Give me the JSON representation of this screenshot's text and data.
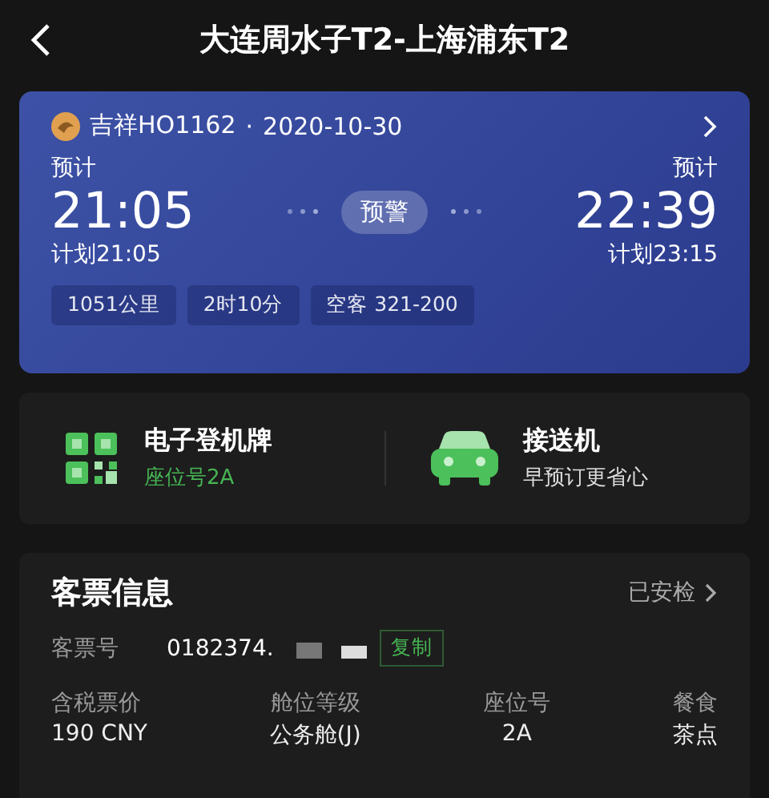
{
  "header": {
    "title": "大连周水子T2-上海浦东T2"
  },
  "flight": {
    "airline_flight": "吉祥HO1162",
    "separator": "·",
    "date": "2020-10-30",
    "departure": {
      "label": "预计",
      "time": "21:05",
      "planned": "计划21:05"
    },
    "status": "预警",
    "arrival": {
      "label": "预计",
      "time": "22:39",
      "planned": "计划23:15"
    },
    "tags": [
      "1051公里",
      "2时10分",
      "空客 321-200"
    ]
  },
  "services": [
    {
      "kind": "boarding-pass",
      "title": "电子登机牌",
      "subtitle": "座位号2A",
      "highlight": true
    },
    {
      "kind": "transfer",
      "title": "接送机",
      "subtitle": "早预订更省心",
      "highlight": false
    }
  ],
  "ticket": {
    "title": "客票信息",
    "status": "已安检",
    "number_label": "客票号",
    "number": "0182374.",
    "copy_button": "复制",
    "columns": [
      {
        "label": "含税票价",
        "value": "190 CNY"
      },
      {
        "label": "舱位等级",
        "value": "公务舱(J)"
      },
      {
        "label": "座位号",
        "value": "2A"
      },
      {
        "label": "餐食",
        "value": "茶点"
      }
    ]
  }
}
